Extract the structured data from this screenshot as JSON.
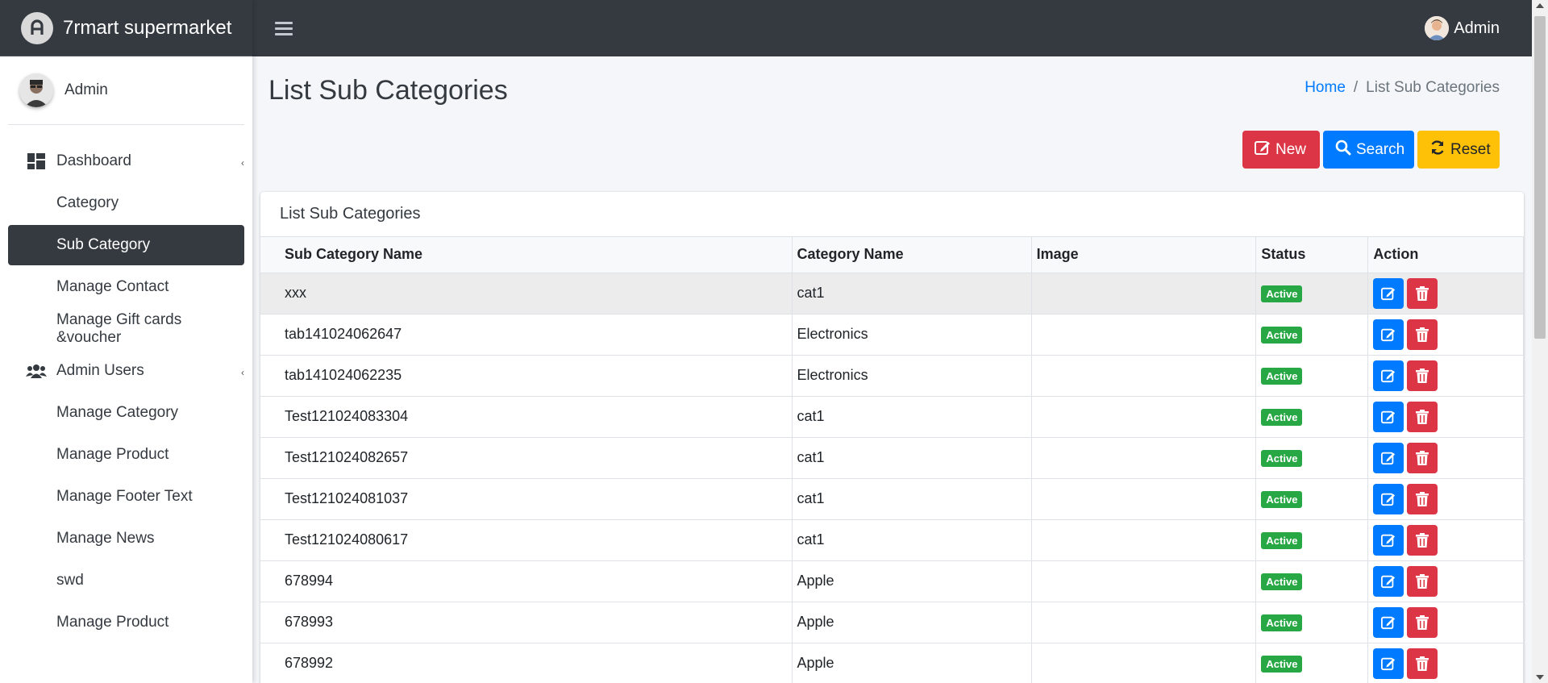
{
  "brand": {
    "name": "7rmart supermarket"
  },
  "sidebar_user": {
    "name": "Admin"
  },
  "sidebar": {
    "items": [
      {
        "label": "Dashboard",
        "level": 1,
        "icon": "dashboard-icon",
        "has_caret": true
      },
      {
        "label": "Category",
        "level": 2
      },
      {
        "label": "Sub Category",
        "level": 2,
        "active": true
      },
      {
        "label": "Manage Contact",
        "level": 2
      },
      {
        "label": "Manage Gift cards &voucher",
        "level": 2
      },
      {
        "label": "Admin Users",
        "level": 1,
        "icon": "users-icon",
        "has_caret": true
      },
      {
        "label": "Manage Category",
        "level": 2
      },
      {
        "label": "Manage Product",
        "level": 2
      },
      {
        "label": "Manage Footer Text",
        "level": 2
      },
      {
        "label": "Manage News",
        "level": 2
      },
      {
        "label": "swd",
        "level": 2
      },
      {
        "label": "Manage Product",
        "level": 2
      }
    ]
  },
  "topbar": {
    "user_name": "Admin"
  },
  "page": {
    "title": "List Sub Categories",
    "breadcrumb_home": "Home",
    "breadcrumb_sep": "/",
    "breadcrumb_current": "List Sub Categories"
  },
  "toolbar": {
    "new_label": "New",
    "search_label": "Search",
    "reset_label": "Reset"
  },
  "table": {
    "title": "List Sub Categories",
    "headers": [
      "Sub Category Name",
      "Category Name",
      "Image",
      "Status",
      "Action"
    ],
    "rows": [
      {
        "sub": "xxx",
        "cat": "cat1",
        "status": "Active"
      },
      {
        "sub": "tab141024062647",
        "cat": "Electronics",
        "status": "Active"
      },
      {
        "sub": "tab141024062235",
        "cat": "Electronics",
        "status": "Active"
      },
      {
        "sub": "Test121024083304",
        "cat": "cat1",
        "status": "Active"
      },
      {
        "sub": "Test121024082657",
        "cat": "cat1",
        "status": "Active"
      },
      {
        "sub": "Test121024081037",
        "cat": "cat1",
        "status": "Active"
      },
      {
        "sub": "Test121024080617",
        "cat": "cat1",
        "status": "Active"
      },
      {
        "sub": "678994",
        "cat": "Apple",
        "status": "Active"
      },
      {
        "sub": "678993",
        "cat": "Apple",
        "status": "Active"
      },
      {
        "sub": "678992",
        "cat": "Apple",
        "status": "Active"
      }
    ]
  },
  "colors": {
    "dark": "#343a40",
    "primary": "#007bff",
    "danger": "#dc3545",
    "warning": "#ffc107",
    "success": "#28a745"
  }
}
